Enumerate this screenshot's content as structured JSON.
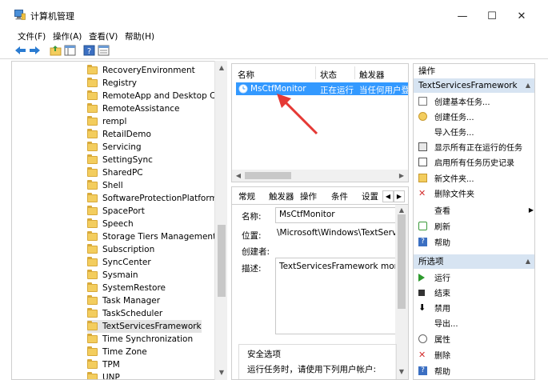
{
  "window": {
    "title": "计算机管理",
    "controls": {
      "minimize": "—",
      "maximize": "☐",
      "close": "✕"
    }
  },
  "menu": [
    "文件(F)",
    "操作(A)",
    "查看(V)",
    "帮助(H)"
  ],
  "toolbar_icons": [
    "back-arrow-icon",
    "forward-arrow-icon",
    "up-folder-icon",
    "show-hide-tree-icon",
    "help-icon",
    "properties-icon"
  ],
  "tree": {
    "items": [
      "RecoveryEnvironment",
      "Registry",
      "RemoteApp and Desktop Conn",
      "RemoteAssistance",
      "rempl",
      "RetailDemo",
      "Servicing",
      "SettingSync",
      "SharedPC",
      "Shell",
      "SoftwareProtectionPlatform",
      "SpacePort",
      "Speech",
      "Storage Tiers Management",
      "Subscription",
      "SyncCenter",
      "Sysmain",
      "SystemRestore",
      "Task Manager",
      "TaskScheduler",
      "TextServicesFramework",
      "Time Synchronization",
      "Time Zone",
      "TPM",
      "UNP"
    ],
    "selected": "TextServicesFramework"
  },
  "task_list": {
    "headers": [
      "名称",
      "状态",
      "触发器"
    ],
    "row": {
      "name": "MsCtfMonitor",
      "status": "正在运行",
      "trigger": "当任何用户登录"
    }
  },
  "details": {
    "tabs": [
      "常规",
      "触发器",
      "操作",
      "条件",
      "设置"
    ],
    "name_label": "名称:",
    "name_value": "MsCtfMonitor",
    "location_label": "位置:",
    "location_value": "\\Microsoft\\Windows\\TextServic",
    "author_label": "创建者:",
    "description_label": "描述:",
    "description_value": "TextServicesFramework monito",
    "security_title": "安全选项",
    "security_text": "运行任务时，请使用下列用户帐户:"
  },
  "actions": {
    "header": "操作",
    "section1": {
      "title": "TextServicesFramework",
      "items": [
        "创建基本任务...",
        "创建任务...",
        "导入任务...",
        "显示所有正在运行的任务",
        "启用所有任务历史记录",
        "新文件夹...",
        "删除文件夹",
        "查看",
        "刷新",
        "帮助"
      ]
    },
    "section2": {
      "title": "所选项",
      "items": [
        "运行",
        "结束",
        "禁用",
        "导出...",
        "属性",
        "删除",
        "帮助"
      ]
    }
  },
  "colors": {
    "selection": "#3399ff",
    "section_highlight": "#d7e4f2",
    "annotation_arrow": "#e53935"
  }
}
